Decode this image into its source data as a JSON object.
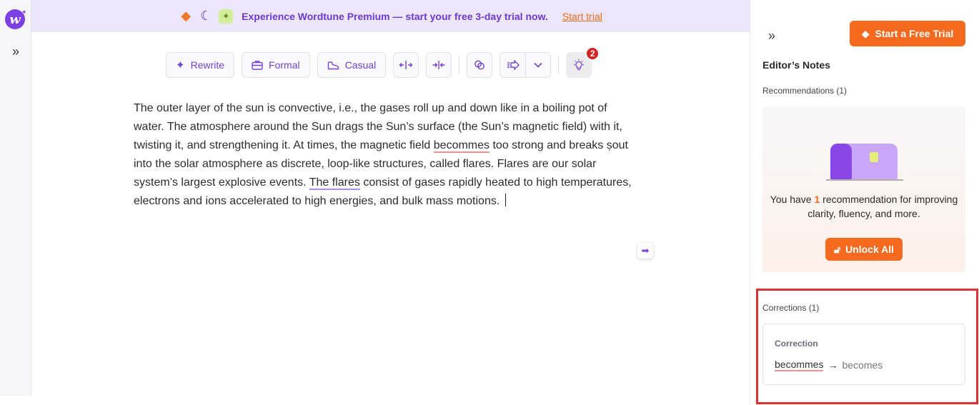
{
  "banner": {
    "text": "Experience Wordtune Premium — start your free 3-day trial now.",
    "link": "Start trial"
  },
  "toolbar": {
    "rewrite": "Rewrite",
    "formal": "Formal",
    "casual": "Casual",
    "badge_count": "2"
  },
  "editor": {
    "t1": "The outer layer of the sun is convective, i.e., the gases roll up and down like in a boiling pot of water. The atmosphere around the Sun drags the Sun’s surface (the Sun’s magnetic field) with it, twisting it, and strengthening it. At times, the magnetic field ",
    "err_word": "becommes",
    "t2": " too strong and breaks ṣout into the solar atmosphere as discrete, loop-like structures, called flares. Flares are our solar system’s largest explosive events. ",
    "suggest_word": "The flares",
    "t3": " consist of gases rapidly heated to high temperatures, electrons and ions accelerated to high energies, and bulk mass motions. "
  },
  "panel": {
    "cta": "Start a Free Trial",
    "notes_title": "Editor’s Notes",
    "recommendations_label": "Recommendations (1)",
    "rec_text_pre": "You have ",
    "rec_count": "1",
    "rec_text_post": " recommendation for improving clarity, fluency, and more.",
    "unlock": "Unlock All",
    "corrections_label": "Corrections (1)",
    "correction_type": "Correction",
    "correction_from": "becommes",
    "correction_arrow": "→",
    "correction_to": "becomes"
  },
  "colors": {
    "brand_purple": "#7b3fe4",
    "accent_orange": "#f56a1e",
    "banner_bg": "#ece6fb",
    "highlight_red": "#d83434"
  }
}
